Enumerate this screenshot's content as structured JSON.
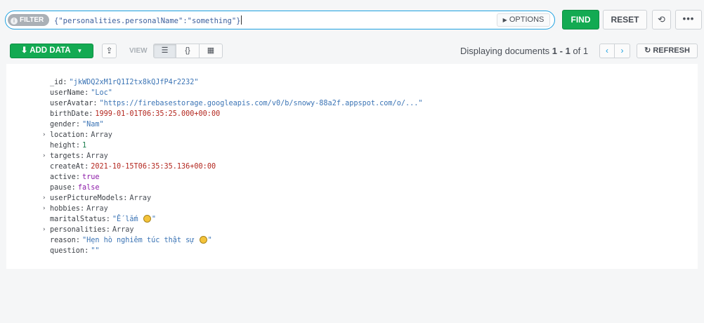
{
  "filter": {
    "pill_label": "FILTER",
    "info_icon": "i",
    "query": "{\"personalities.personalName\":\"something\"}",
    "options_label": "OPTIONS"
  },
  "toolbar": {
    "find_label": "FIND",
    "reset_label": "RESET",
    "history_icon": "⟲",
    "more_icon": "•••",
    "add_data_label": "ADD DATA",
    "view_label": "VIEW",
    "refresh_label": "REFRESH"
  },
  "pagination": {
    "prefix": "Displaying documents ",
    "range": "1 - 1",
    "of_text": " of ",
    "total": "1"
  },
  "document": {
    "fields": [
      {
        "key": "_id",
        "value": "\"jkWDQ2xM1rQ1I2tx8kQJfP4r2232\"",
        "type": "string",
        "expandable": false
      },
      {
        "key": "userName",
        "value": "\"Loc\"",
        "type": "string",
        "expandable": false
      },
      {
        "key": "userAvatar",
        "value": "\"https://firebasestorage.googleapis.com/v0/b/snowy-88a2f.appspot.com/o/...\"",
        "type": "string",
        "expandable": false
      },
      {
        "key": "birthDate",
        "value": "1999-01-01T06:35:25.000+00:00",
        "type": "date",
        "expandable": false
      },
      {
        "key": "gender",
        "value": "\"Nam\"",
        "type": "string",
        "expandable": false
      },
      {
        "key": "location",
        "value": "Array",
        "type": "type",
        "expandable": true
      },
      {
        "key": "height",
        "value": "1",
        "type": "number",
        "expandable": false
      },
      {
        "key": "targets",
        "value": "Array",
        "type": "type",
        "expandable": true
      },
      {
        "key": "createAt",
        "value": "2021-10-15T06:35:35.136+00:00",
        "type": "date",
        "expandable": false
      },
      {
        "key": "active",
        "value": "true",
        "type": "bool",
        "expandable": false
      },
      {
        "key": "pause",
        "value": "false",
        "type": "bool",
        "expandable": false
      },
      {
        "key": "userPictureModels",
        "value": "Array",
        "type": "type",
        "expandable": true
      },
      {
        "key": "hobbies",
        "value": "Array",
        "type": "type",
        "expandable": true
      },
      {
        "key": "maritalStatus",
        "value": "\"Ế lắm ",
        "value_end": "\"",
        "emoji": "worried-face-emoji",
        "type": "string",
        "expandable": false
      },
      {
        "key": "personalities",
        "value": "Array",
        "type": "type",
        "expandable": true
      },
      {
        "key": "reason",
        "value": "\"Hẹn hò nghiêm túc thật sự ",
        "value_end": "\"",
        "emoji": "neutral-face-emoji",
        "type": "string",
        "expandable": false
      },
      {
        "key": "question",
        "value": "\"\"",
        "type": "string",
        "expandable": false
      }
    ]
  },
  "colors": {
    "find_green": "#13aa52",
    "filter_border": "#1ea1e0",
    "string_value": "#3b74b5",
    "date_value": "#b3261e",
    "bool_value": "#8c1aa8"
  }
}
